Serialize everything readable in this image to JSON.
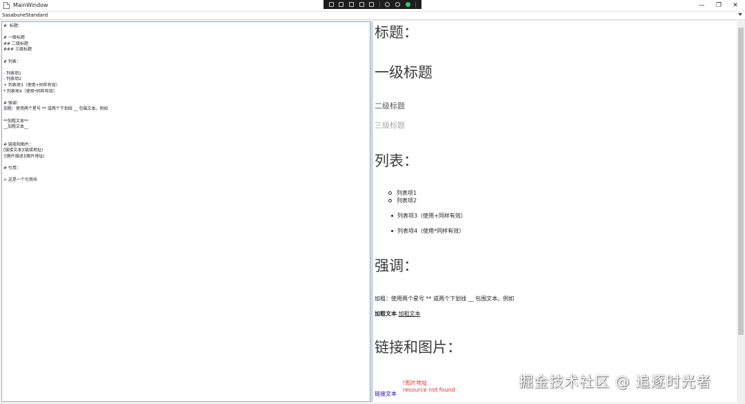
{
  "window": {
    "title": "MainWindow",
    "controls": {
      "minimize": "—",
      "maximize": "❐",
      "close": "✕"
    }
  },
  "font_select": {
    "value": "SasabuneStandard"
  },
  "editor": {
    "lines": [
      "#  标题：",
      "",
      "# 一级标题",
      "## 二级标题",
      "### 三级标题",
      "",
      "# 列表：",
      "",
      "- 列表项1",
      "- 列表项2",
      "+ 列表项3（使用+同样有效）",
      "* 列表项4（使用*同样有效）",
      "",
      "# 强调：",
      "加粗：使用两个星号 ** 或两个下划线 __ 包围文本。例如",
      "",
      "**加粗文本**",
      "__加粗文本__",
      "",
      "",
      "# 链接和图片：",
      "[链接文本](链接地址)",
      "![图片描述](图片地址)",
      "",
      "# 引用：",
      "",
      "> 这是一个引用块"
    ]
  },
  "preview": {
    "heading_title": "标题：",
    "h1": "一级标题",
    "h2": "二级标题",
    "h3": "三级标题",
    "list_heading": "列表：",
    "list_items_a": [
      "列表项1",
      "列表项2"
    ],
    "list_item_3": "列表项3（使用+同样有效）",
    "list_item_4": "列表项4（使用*同样有效）",
    "emphasis_heading": "强调：",
    "emphasis_paragraph": "加粗：使用两个星号 ** 或两个下划线 __ 包围文本。例如",
    "bold_text": "加粗文本",
    "underline_text": "加粗文本",
    "links_heading": "链接和图片：",
    "link_text": "链接文本",
    "image_alt": "!图片地址",
    "image_error": "resource not found"
  },
  "watermark": "掘金技术社区 @ 追逐时光者"
}
